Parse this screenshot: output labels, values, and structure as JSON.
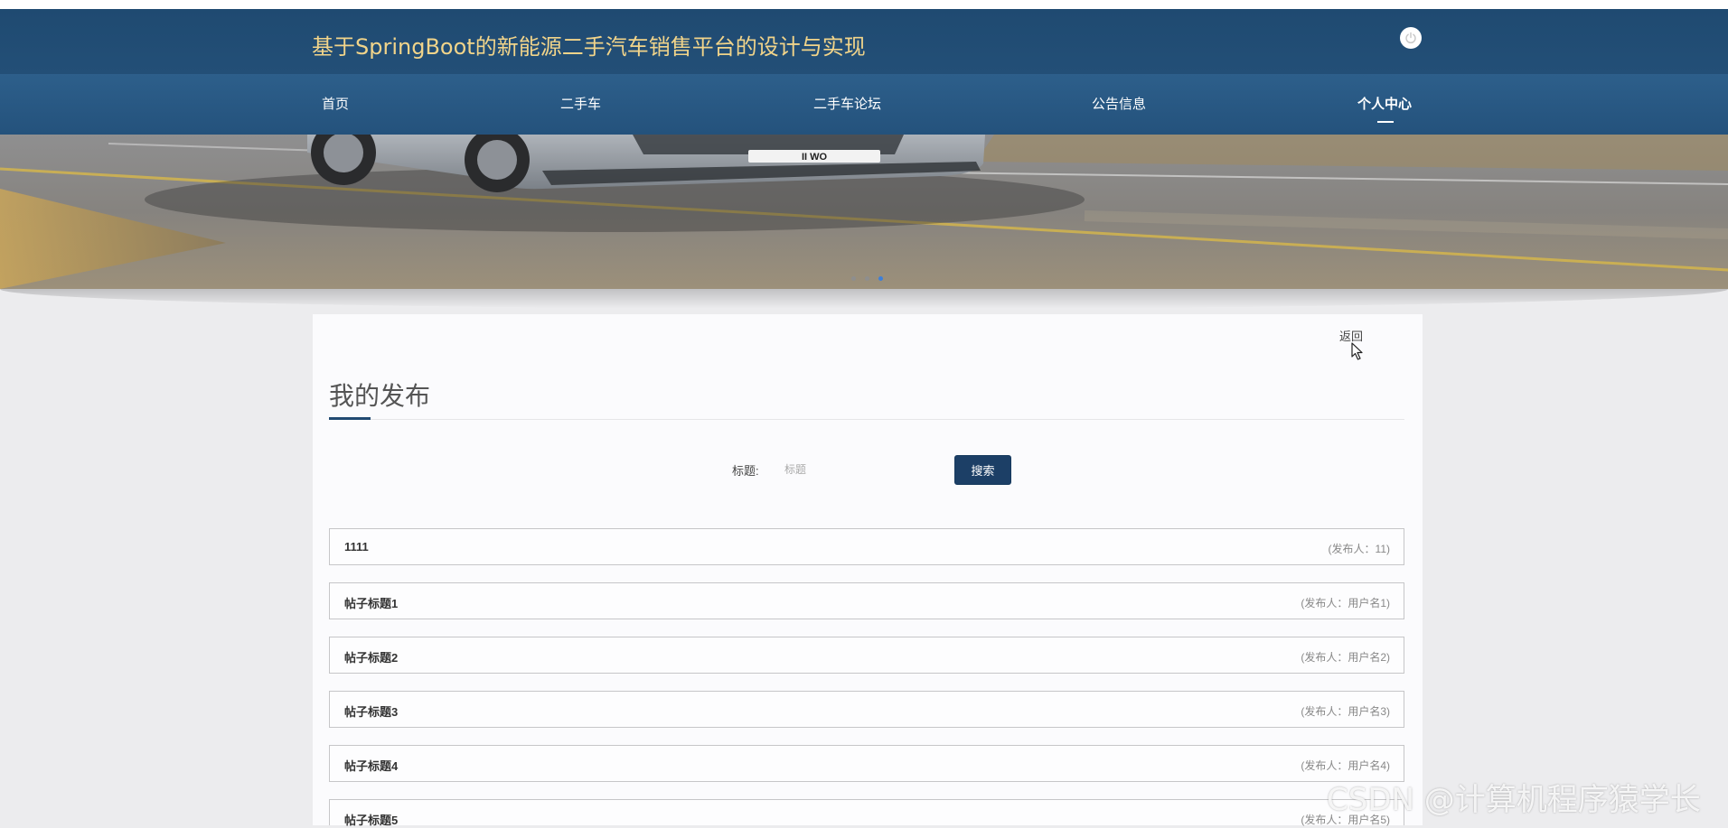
{
  "header": {
    "site_title": "基于SpringBoot的新能源二手汽车销售平台的设计与实现"
  },
  "nav": {
    "items": [
      {
        "label": "首页"
      },
      {
        "label": "二手车"
      },
      {
        "label": "二手车论坛"
      },
      {
        "label": "公告信息"
      },
      {
        "label": "个人中心",
        "active": true
      }
    ]
  },
  "banner": {
    "plate_text": "II WO",
    "dots": 3,
    "active_dot": 3
  },
  "page": {
    "back_label": "返回",
    "section_title": "我的发布"
  },
  "search": {
    "label": "标题:",
    "placeholder": "标题",
    "button_label": "搜索"
  },
  "posts": [
    {
      "title": "1111",
      "author": "(发布人：11)"
    },
    {
      "title": "帖子标题1",
      "author": "(发布人：用户名1)"
    },
    {
      "title": "帖子标题2",
      "author": "(发布人：用户名2)"
    },
    {
      "title": "帖子标题3",
      "author": "(发布人：用户名3)"
    },
    {
      "title": "帖子标题4",
      "author": "(发布人：用户名4)"
    },
    {
      "title": "帖子标题5",
      "author": "(发布人：用户名5)"
    }
  ],
  "watermark": "CSDN @计算机程序猿学长",
  "colors": {
    "header_bg": "#1f4a71",
    "nav_bg": "#2d5f8b",
    "title_gold": "#f1d48a",
    "accent": "#214a72",
    "button_bg": "#1c3f66",
    "active_dot": "#3d7fd9"
  },
  "icons": {
    "logout": "power-icon",
    "cursor": "mouse-pointer-icon"
  }
}
